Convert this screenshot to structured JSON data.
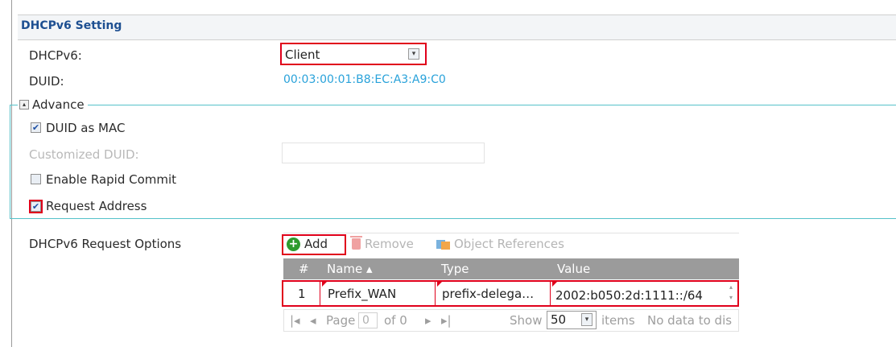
{
  "section_title": "DHCPv6 Setting",
  "dhcpv6": {
    "label": "DHCPv6:",
    "selected": "Client"
  },
  "duid": {
    "label": "DUID:",
    "value": "00:03:00:01:B8:EC:A3:A9:C0"
  },
  "advance": {
    "legend": "Advance",
    "duid_as_mac": {
      "label": "DUID as MAC",
      "checked": true
    },
    "customized_duid": {
      "label": "Customized DUID:",
      "value": ""
    },
    "enable_rapid_commit": {
      "label": "Enable Rapid Commit",
      "checked": false
    },
    "request_address": {
      "label": "Request Address",
      "checked": true
    }
  },
  "request_options": {
    "label": "DHCPv6 Request Options",
    "toolbar": {
      "add": "Add",
      "remove": "Remove",
      "object_references": "Object References"
    },
    "columns": [
      "#",
      "Name ▴",
      "Type",
      "Value"
    ],
    "rows": [
      {
        "num": "1",
        "name": "Prefix_WAN",
        "type": "prefix-delega…",
        "value": "2002:b050:2d:1111::/64"
      }
    ],
    "pager": {
      "page_label": "Page",
      "page_value": "0",
      "of_label": "of 0",
      "show_label": "Show",
      "show_value": "50",
      "items_label": "items",
      "no_data": "No data to dis"
    }
  },
  "icons": {
    "checked": "✔",
    "arrow": "▾",
    "collapse": "▴"
  }
}
